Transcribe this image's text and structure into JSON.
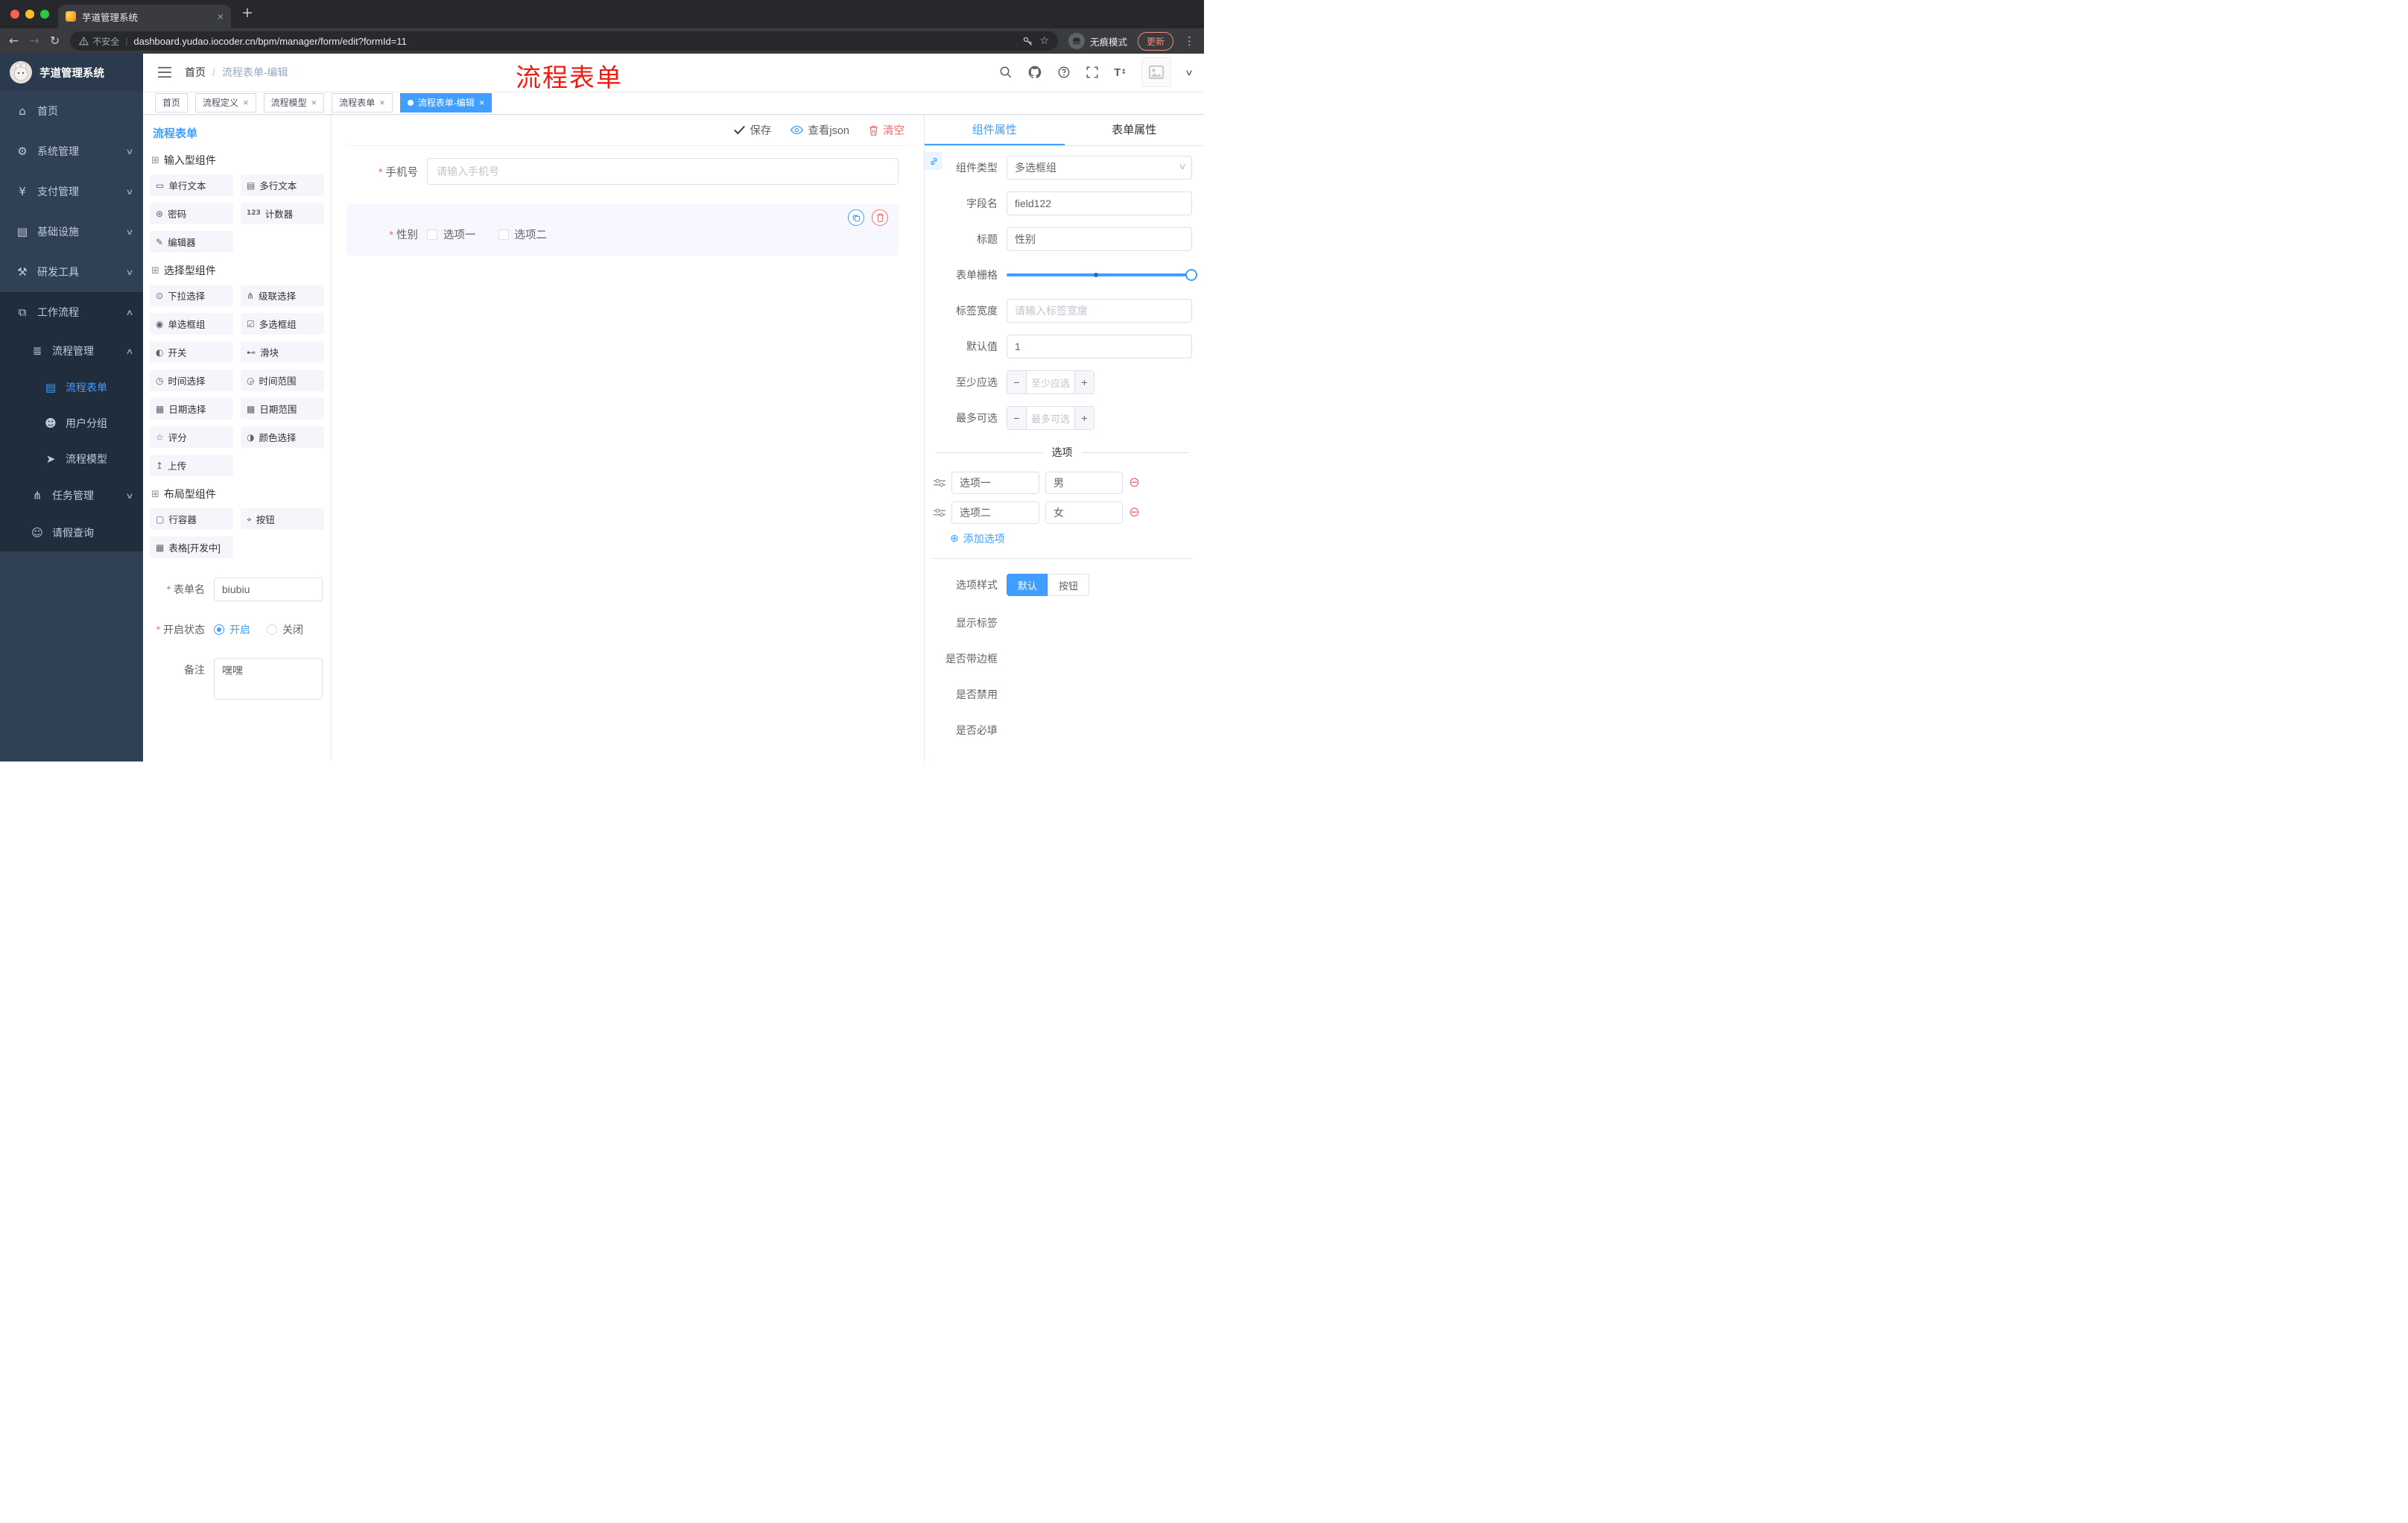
{
  "browser": {
    "tab_title": "芋道管理系统",
    "security_label": "不安全",
    "url": "dashboard.yudao.iocoder.cn/bpm/manager/form/edit?formId=11",
    "incognito_label": "无痕模式",
    "update_label": "更新"
  },
  "sidebar": {
    "logo_title": "芋道管理系统",
    "items": [
      {
        "icon": "⌂",
        "label": "首页"
      },
      {
        "icon": "⚙",
        "label": "系统管理",
        "chevron": "∨"
      },
      {
        "icon": "¥",
        "label": "支付管理",
        "chevron": "∨"
      },
      {
        "icon": "▤",
        "label": "基础设施",
        "chevron": "∨"
      },
      {
        "icon": "⚒",
        "label": "研发工具",
        "chevron": "∨"
      },
      {
        "icon": "⧉",
        "label": "工作流程",
        "chevron": "∧"
      },
      {
        "icon": "≣",
        "label": "流程管理",
        "chevron": "∧"
      },
      {
        "icon": "▤",
        "label": "流程表单"
      },
      {
        "icon": "☻",
        "label": "用户分组"
      },
      {
        "icon": "➤",
        "label": "流程模型"
      },
      {
        "icon": "⋔",
        "label": "任务管理",
        "chevron": "∨"
      },
      {
        "icon": "☺",
        "label": "请假查询"
      }
    ]
  },
  "header": {
    "breadcrumb": {
      "home": "首页",
      "separator": "/",
      "current": "流程表单-编辑"
    },
    "annotation": "流程表单"
  },
  "tags_view": [
    {
      "label": "首页"
    },
    {
      "label": "流程定义"
    },
    {
      "label": "流程模型"
    },
    {
      "label": "流程表单"
    },
    {
      "label": "流程表单-编辑"
    }
  ],
  "palette": {
    "title": "流程表单",
    "groups": [
      {
        "title": "输入型组件",
        "items": [
          {
            "icon": "▭",
            "label": "单行文本"
          },
          {
            "icon": "▤",
            "label": "多行文本"
          },
          {
            "icon": "⊛",
            "label": "密码"
          },
          {
            "icon": "123",
            "label": "计数器"
          },
          {
            "icon": "✎",
            "label": "编辑器"
          }
        ]
      },
      {
        "title": "选择型组件",
        "items": [
          {
            "icon": "⊙",
            "label": "下拉选择"
          },
          {
            "icon": "⋔",
            "label": "级联选择"
          },
          {
            "icon": "◉",
            "label": "单选框组"
          },
          {
            "icon": "☑",
            "label": "多选框组"
          },
          {
            "icon": "◐",
            "label": "开关"
          },
          {
            "icon": "⊷",
            "label": "滑块"
          },
          {
            "icon": "◷",
            "label": "时间选择"
          },
          {
            "icon": "◶",
            "label": "时间范围"
          },
          {
            "icon": "▦",
            "label": "日期选择"
          },
          {
            "icon": "▩",
            "label": "日期范围"
          },
          {
            "icon": "☆",
            "label": "评分"
          },
          {
            "icon": "◑",
            "label": "颜色选择"
          },
          {
            "icon": "↥",
            "label": "上传"
          }
        ]
      },
      {
        "title": "布局型组件",
        "items": [
          {
            "icon": "▢",
            "label": "行容器"
          },
          {
            "icon": "⌖",
            "label": "按钮"
          },
          {
            "icon": "▦",
            "label": "表格[开发中]"
          }
        ]
      }
    ],
    "form": {
      "name_label": "表单名",
      "name_value": "biubiu",
      "status_label": "开启状态",
      "status_on": "开启",
      "status_off": "关闭",
      "remark_label": "备注",
      "remark_value": "嘿嘿"
    }
  },
  "canvas": {
    "toolbar": {
      "save": "保存",
      "view_json": "查看json",
      "clear": "清空"
    },
    "phone": {
      "label": "手机号",
      "placeholder": "请输入手机号"
    },
    "gender": {
      "label": "性别",
      "option1": "选项一",
      "option2": "选项二"
    }
  },
  "inspector": {
    "tab_component": "组件属性",
    "tab_form": "表单属性",
    "component_type_label": "组件类型",
    "component_type_value": "多选框组",
    "field_label": "字段名",
    "field_value": "field122",
    "title_label": "标题",
    "title_value": "性别",
    "grid_label": "表单栅格",
    "label_width_label": "标签宽度",
    "label_width_placeholder": "请输入标签宽度",
    "default_label": "默认值",
    "default_value": "1",
    "min_label": "至少应选",
    "min_placeholder": "至少应选",
    "max_label": "最多可选",
    "max_placeholder": "最多可选",
    "options_header": "选项",
    "options": [
      {
        "name": "选项一",
        "value": "男"
      },
      {
        "name": "选项二",
        "value": "女"
      }
    ],
    "add_option": "添加选项",
    "style_label": "选项样式",
    "style_default": "默认",
    "style_button": "按钮",
    "switches": [
      {
        "label": "显示标签",
        "on": true
      },
      {
        "label": "是否带边框",
        "on": false
      },
      {
        "label": "是否禁用",
        "on": false
      },
      {
        "label": "是否必填",
        "on": true
      }
    ]
  },
  "colors": {
    "accent": "#409eff",
    "danger": "#f56c6c",
    "annotation_red": "#f41a0e",
    "sidebar_bg": "#304156",
    "submenu_bg": "#1f2d3d"
  }
}
